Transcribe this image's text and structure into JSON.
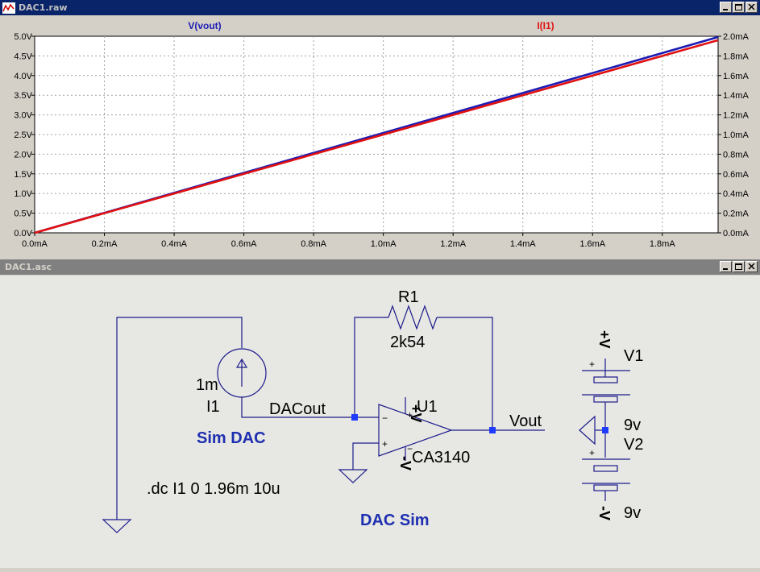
{
  "plot_window": {
    "title": "DAC1.raw",
    "trace_left_label": "V(vout)",
    "trace_right_label": "I(I1)",
    "left_ticks": [
      "5.0V",
      "4.5V",
      "4.0V",
      "3.5V",
      "3.0V",
      "2.5V",
      "2.0V",
      "1.5V",
      "1.0V",
      "0.5V",
      "0.0V"
    ],
    "right_ticks": [
      "2.0mA",
      "1.8mA",
      "1.6mA",
      "1.4mA",
      "1.2mA",
      "1.0mA",
      "0.8mA",
      "0.6mA",
      "0.4mA",
      "0.2mA",
      "0.0mA"
    ],
    "x_ticks": [
      "0.0mA",
      "0.2mA",
      "0.4mA",
      "0.6mA",
      "0.8mA",
      "1.0mA",
      "1.2mA",
      "1.4mA",
      "1.6mA",
      "1.8mA"
    ],
    "colors": {
      "vout": "#1c1cb4",
      "i1": "#e01010",
      "left_label": "#1c1cb4",
      "right_label": "#e01010"
    }
  },
  "chart_data": {
    "type": "line",
    "x_unit": "mA",
    "xlim": [
      0,
      1.96
    ],
    "y_left_lim": [
      0,
      5.0
    ],
    "y_right_lim": [
      0,
      2.0
    ],
    "grid": true,
    "series": [
      {
        "name": "V(vout)",
        "axis": "left",
        "x": [
          0,
          1.96
        ],
        "y": [
          0,
          4.98
        ]
      },
      {
        "name": "I(I1)",
        "axis": "right",
        "x": [
          0,
          1.96
        ],
        "y": [
          0,
          1.96
        ]
      }
    ]
  },
  "schematic_window": {
    "title": "DAC1.asc",
    "labels": {
      "r1_name": "R1",
      "r1_value": "2k54",
      "i1_value": "1m",
      "i1_name": "I1",
      "dacout": "DACout",
      "sim_dac": "Sim DAC",
      "u1_name": "U1",
      "u1_part": "CA3140",
      "vout": "Vout",
      "dc_cmd": ".dc I1 0 1.96m 10u",
      "dac_sim": "DAC Sim",
      "v1_name": "V1",
      "v1_value": "9v",
      "v2_name": "V2",
      "v2_value": "9v",
      "vplus": "+V",
      "vminus": "-V",
      "plus": "+",
      "minus": "−"
    },
    "colors": {
      "wire": "#1c1c8c",
      "text": "#000000",
      "comment": "#1e2fb0",
      "node": "#1e3cff"
    }
  }
}
